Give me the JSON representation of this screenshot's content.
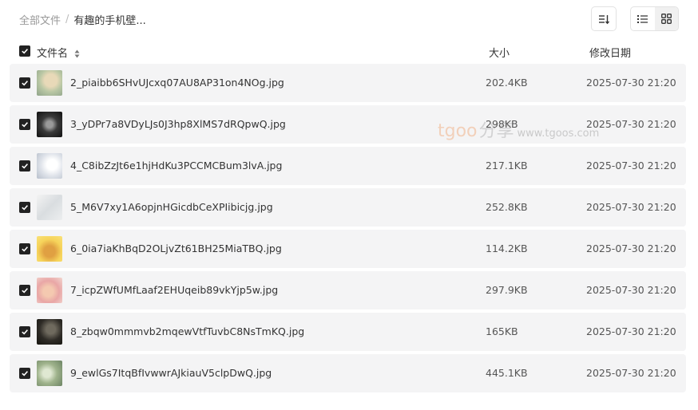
{
  "breadcrumb": {
    "root": "全部文件",
    "separator": "/",
    "current": "有趣的手机壁..."
  },
  "toolbar": {
    "sort_icon": "sort-icon",
    "list_view_icon": "list-view-icon",
    "grid_view_icon": "grid-view-icon",
    "active_view": "list"
  },
  "columns": {
    "name": "文件名",
    "size": "大小",
    "date": "修改日期"
  },
  "files": [
    {
      "name": "2_piaibb6SHvUJcxq07AU8AP31on4NOg.jpg",
      "size": "202.4KB",
      "date": "2025-07-30 21:20",
      "checked": true
    },
    {
      "name": "3_yDPr7a8VDyLJs0J3hp8XlMS7dRQpwQ.jpg",
      "size": "298KB",
      "date": "2025-07-30 21:20",
      "checked": true
    },
    {
      "name": "4_C8ibZzJt6e1hjHdKu3PCCMCBum3lvA.jpg",
      "size": "217.1KB",
      "date": "2025-07-30 21:20",
      "checked": true
    },
    {
      "name": "5_M6V7xy1A6opjnHGicdbCeXPIibicjg.jpg",
      "size": "252.8KB",
      "date": "2025-07-30 21:20",
      "checked": true
    },
    {
      "name": "6_0ia7iaKhBqD2OLjvZt61BH25MiaTBQ.jpg",
      "size": "114.2KB",
      "date": "2025-07-30 21:20",
      "checked": true
    },
    {
      "name": "7_icpZWfUMfLaaf2EHUqeib89vkYjp5w.jpg",
      "size": "297.9KB",
      "date": "2025-07-30 21:20",
      "checked": true
    },
    {
      "name": "8_zbqw0mmmvb2mqewVtfTuvbC8NsTmKQ.jpg",
      "size": "165KB",
      "date": "2025-07-30 21:20",
      "checked": true
    },
    {
      "name": "9_ewlGs7ItqBfIvwwrAJkiauV5clpDwQ.jpg",
      "size": "445.1KB",
      "date": "2025-07-30 21:20",
      "checked": true
    }
  ],
  "watermark": {
    "brand": "tgoo",
    "brand_cn": "分享",
    "url": "www.tgoos.com"
  },
  "colors": {
    "row_bg": "#f4f4f5",
    "checkbox": "#222222",
    "active_view_bg": "#f0f0f0"
  }
}
